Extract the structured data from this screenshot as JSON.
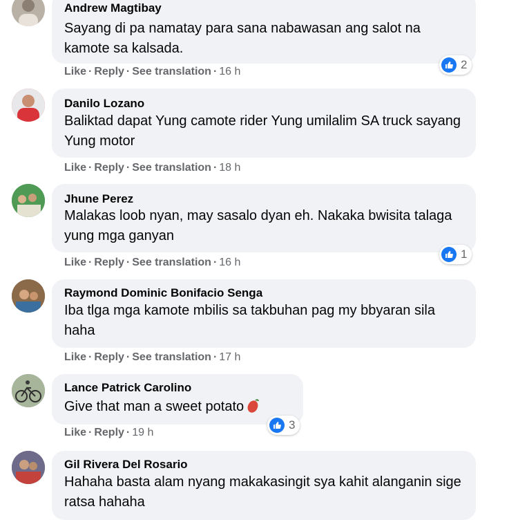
{
  "action_labels": {
    "like": "Like",
    "reply": "Reply",
    "see_translation": "See translation",
    "separator": "·"
  },
  "comments": [
    {
      "author": "Andrew Magtibay",
      "text": "Sayang di pa namatay para sana nabawasan ang salot na kamote sa kalsada.",
      "time": "16 h",
      "reaction_count": "2",
      "avatar_color": "#b9b1a6"
    },
    {
      "author": "Danilo Lozano",
      "text": "Baliktad dapat Yung camote rider Yung umilalim SA truck sayang Yung motor",
      "time": "18 h",
      "avatar_color": "#d8343a"
    },
    {
      "author": "Jhune Perez",
      "text": "Malakas loob nyan, may sasalo dyan eh. Nakaka bwisita talaga yung mga ganyan",
      "time": "16 h",
      "reaction_count": "1",
      "avatar_color": "#3f8a4a"
    },
    {
      "author": "Raymond Dominic Bonifacio Senga",
      "text": "Iba tlga mga kamote mbilis sa takbuhan pag my bbyaran sila haha",
      "time": "17 h",
      "avatar_color": "#7a5c3f"
    },
    {
      "author": "Lance Patrick Carolino",
      "text": "Give that man a sweet potato",
      "time": "19 h",
      "reaction_count": "3",
      "avatar_color": "#6d7d63"
    },
    {
      "author": "Gil Rivera Del Rosario",
      "text": "Hahaha basta alam nyang makakasingit sya kahit alanganin sige ratsa hahaha",
      "avatar_color": "#5a4c66"
    }
  ],
  "colors": {
    "bubble": "#f0f2f5",
    "like_blue": "#1877f2",
    "secondary_text": "#65676b"
  },
  "icons": {
    "like_reaction": "like-icon",
    "emoji": "sweet-potato-icon"
  }
}
